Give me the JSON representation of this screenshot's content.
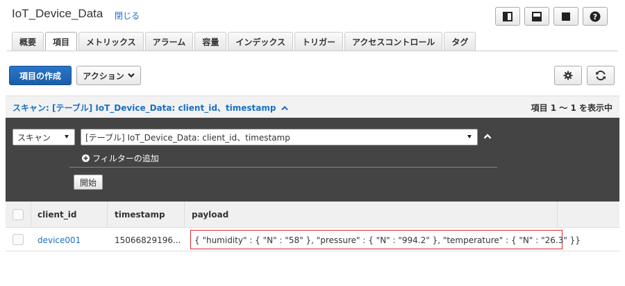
{
  "header": {
    "title": "IoT_Device_Data",
    "close_label": "閉じる"
  },
  "tabs": [
    {
      "label": "概要",
      "active": false
    },
    {
      "label": "項目",
      "active": true
    },
    {
      "label": "メトリックス",
      "active": false
    },
    {
      "label": "アラーム",
      "active": false
    },
    {
      "label": "容量",
      "active": false
    },
    {
      "label": "インデックス",
      "active": false
    },
    {
      "label": "トリガー",
      "active": false
    },
    {
      "label": "アクセスコントロール",
      "active": false
    },
    {
      "label": "タグ",
      "active": false
    }
  ],
  "toolbar": {
    "create_label": "項目の作成",
    "actions_label": "アクション"
  },
  "scan": {
    "summary": "スキャン: [テーブル] IoT_Device_Data: client_id、timestamp",
    "count_text": "項目 1 ～ 1 を表示中",
    "mode_value": "スキャン",
    "table_value": "[テーブル] IoT_Device_Data: client_id、timestamp",
    "add_filter_label": "フィルターの追加",
    "start_label": "開始"
  },
  "table": {
    "columns": [
      "client_id",
      "timestamp",
      "payload"
    ],
    "rows": [
      {
        "client_id": "device001",
        "timestamp": "15066829196...",
        "payload": "{ \"humidity\" : { \"N\" : \"58\" }, \"pressure\" : { \"N\" : \"994.2\" }, \"temperature\" : { \"N\" : \"26.3\" }}"
      }
    ]
  },
  "colors": {
    "accent": "#1a6fc4",
    "primary_button": "#1b5ea8",
    "highlight_border": "#d9262c",
    "panel_bg": "#444444"
  },
  "icons": [
    "panel-left-icon",
    "panel-bottom-icon",
    "panel-full-icon",
    "help-icon",
    "chevron-down-icon",
    "chevron-up-icon",
    "gear-icon",
    "refresh-icon",
    "plus-circle-icon"
  ]
}
